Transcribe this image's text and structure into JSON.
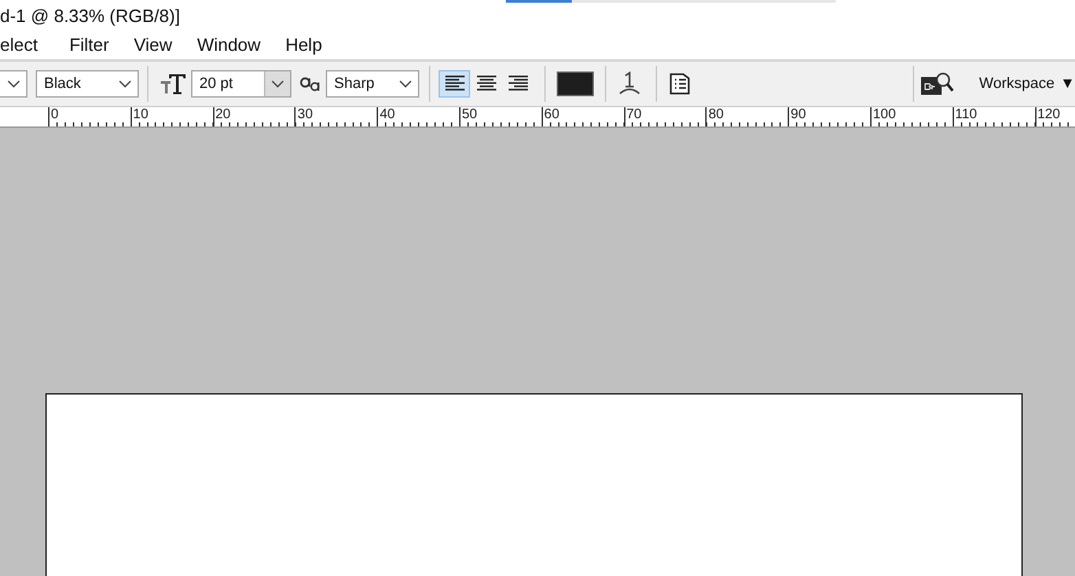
{
  "window": {
    "title": "d-1 @ 8.33% (RGB/8)]",
    "progress": {
      "level": 0.2
    }
  },
  "menu": [
    "elect",
    "Filter",
    "View",
    "Window",
    "Help"
  ],
  "options_bar": {
    "font_style": {
      "value": "Black"
    },
    "font_size": {
      "value": "20 pt"
    },
    "anti_alias": {
      "value": "Sharp"
    },
    "alignment": [
      {
        "kind": "left",
        "selected": true
      },
      {
        "kind": "center",
        "selected": false
      },
      {
        "kind": "right",
        "selected": false
      }
    ],
    "text_color": {
      "color": "#1e1e1e"
    },
    "workspace": {
      "label": "Workspace",
      "caret": "▼"
    }
  },
  "ruler": [
    "0",
    "10",
    "20",
    "30",
    "40",
    "50",
    "60",
    "70",
    "80",
    "90",
    "100",
    "110",
    "120"
  ]
}
